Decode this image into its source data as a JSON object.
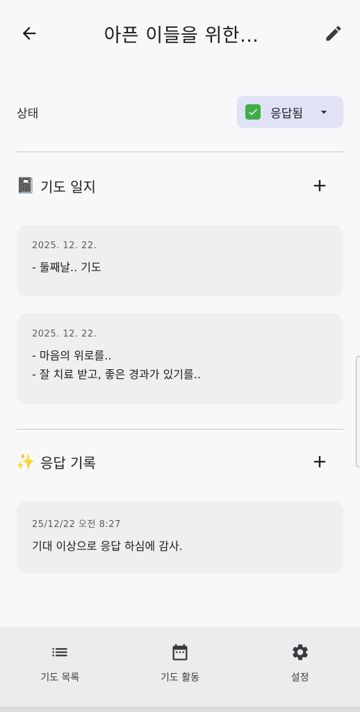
{
  "header": {
    "title": "아픈 이들을 위한...",
    "back_icon": "arrow-left-icon",
    "edit_icon": "pencil-icon"
  },
  "status": {
    "label": "상태",
    "value": "응답됨",
    "icon": "check-box-icon",
    "accent": "#3fae49",
    "dropdown_bg": "#dfe3f5"
  },
  "journal": {
    "emoji": "📓",
    "title": "기도 일지",
    "add_icon": "plus-icon",
    "entries": [
      {
        "date": "2025. 12. 22.",
        "lines": [
          "- 둘째날.. 기도"
        ]
      },
      {
        "date": "2025. 12. 22.",
        "lines": [
          "- 마음의 위로를..",
          "- 잘 치료 받고, 좋은 경과가 있기를.."
        ]
      }
    ]
  },
  "answers": {
    "emoji": "✨",
    "title": "응답 기록",
    "add_icon": "plus-icon",
    "entries": [
      {
        "date": "25/12/22 오전 8:27",
        "lines": [
          "기대 이상으로 응답 하심에 감사."
        ]
      }
    ]
  },
  "nav": {
    "items": [
      {
        "label": "기도 목록",
        "icon": "list-icon"
      },
      {
        "label": "기도 활동",
        "icon": "calendar-icon"
      },
      {
        "label": "설정",
        "icon": "gear-icon"
      }
    ]
  }
}
